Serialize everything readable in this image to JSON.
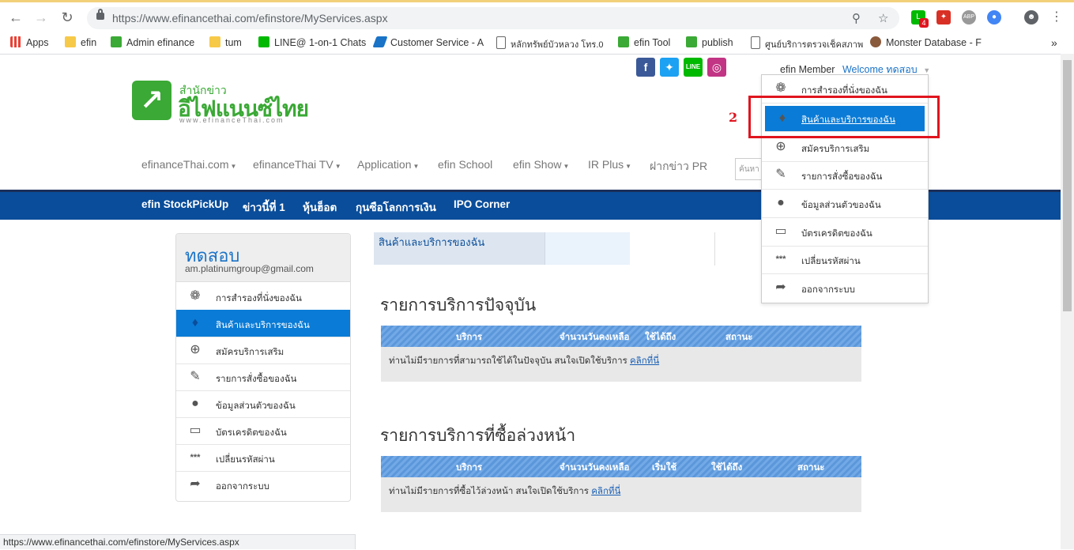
{
  "browser": {
    "url": "https://www.efinancethai.com/efinstore/MyServices.aspx",
    "bookmarks": [
      {
        "label": "Apps",
        "icon": "apps-grid-icon",
        "color": "#e94235"
      },
      {
        "label": "efin",
        "icon": "folder-icon",
        "color": "#f7c948"
      },
      {
        "label": "Admin efinance",
        "icon": "efin-icon",
        "color": "#3aa935"
      },
      {
        "label": "tum",
        "icon": "folder-icon",
        "color": "#f7c948"
      },
      {
        "label": "LINE@ 1-on-1 Chats",
        "icon": "line-icon",
        "color": "#00b900"
      },
      {
        "label": "Customer Service - A",
        "icon": "ticket-icon",
        "color": "#1a73c7"
      },
      {
        "label": "หลักทรัพย์บัวหลวง โทร.0",
        "icon": "page-icon",
        "color": "#ffffff"
      },
      {
        "label": "efin Tool",
        "icon": "efin-icon",
        "color": "#3aa935"
      },
      {
        "label": "publish",
        "icon": "efin-icon",
        "color": "#3aa935"
      },
      {
        "label": "ศูนย์บริการตรวจเช็คสภาพ",
        "icon": "page-icon",
        "color": "#ffffff"
      },
      {
        "label": "Monster Database - F",
        "icon": "monster-icon",
        "color": "#8a5a3c"
      }
    ],
    "status_url": "https://www.efinancethai.com/efinstore/MyServices.aspx",
    "ext_badge": "4",
    "ext_abp": "ABP"
  },
  "header": {
    "logo_line1": "สำนักข่าว",
    "logo_line2": "อีไฟแนนซ์ไทย",
    "logo_line3": "www.efinanceThai.com",
    "social": [
      {
        "name": "facebook",
        "glyph": "f",
        "color": "#3b5998"
      },
      {
        "name": "twitter",
        "glyph": "t",
        "color": "#1da1f2"
      },
      {
        "name": "line",
        "glyph": "L",
        "color": "#00b900"
      },
      {
        "name": "instagram",
        "glyph": "◎",
        "color": "#c13584"
      }
    ],
    "member_label": "efin Member",
    "welcome_label": "Welcome ทดสอบ",
    "search_placeholder": "ค้นหา"
  },
  "topnav": [
    "efinanceThai.com",
    "efinanceThai TV",
    "Application",
    "efin School",
    "efin Show",
    "IR Plus",
    "ฝากข่าว PR"
  ],
  "bluebar": [
    "efin StockPickUp",
    "ข่าวนี้ที่ 1",
    "หุ้นฮ็อต",
    "กุนซือโลกการเงิน",
    "IPO Corner"
  ],
  "sidebar": {
    "name": "ทดสอบ",
    "email": "am.platinumgroup@gmail.com",
    "items": [
      {
        "label": "การสำรองที่นั่งของฉัน",
        "icon": "seat-icon"
      },
      {
        "label": "สินค้าและบริการของฉัน",
        "icon": "tag-icon"
      },
      {
        "label": "สมัครบริการเสริม",
        "icon": "add-tag-icon"
      },
      {
        "label": "รายการสั่งซื้อของฉัน",
        "icon": "order-list-icon"
      },
      {
        "label": "ข้อมูลส่วนตัวของฉัน",
        "icon": "user-icon"
      },
      {
        "label": "บัตรเครดิตของฉัน",
        "icon": "credit-card-icon"
      },
      {
        "label": "เปลี่ยนรหัสผ่าน",
        "icon": "password-icon"
      },
      {
        "label": "ออกจากระบบ",
        "icon": "logout-icon"
      }
    ]
  },
  "main": {
    "tab_label": "สินค้าและบริการของฉัน",
    "current": {
      "title": "รายการบริการปัจจุบัน",
      "headers": [
        "บริการ",
        "จำนวนวันคงเหลือ",
        "ใช้ได้ถึง",
        "สถานะ"
      ],
      "message": "ท่านไม่มีรายการที่สามารถใช้ได้ในปัจจุบัน สนใจเปิดใช้บริการ",
      "link": "คลิกที่นี่"
    },
    "advance": {
      "title": "รายการบริการที่ซื้อล่วงหน้า",
      "headers": [
        "บริการ",
        "จำนวนวันคงเหลือ",
        "เริ่มใช้",
        "ใช้ได้ถึง",
        "สถานะ"
      ],
      "message": "ท่านไม่มีรายการที่ซื้อไว้ล่วงหน้า สนใจเปิดใช้บริการ",
      "link": "คลิกที่นี่"
    }
  },
  "dropdown": {
    "items": [
      {
        "label": "การสำรองที่นั่งของฉัน",
        "icon": "seat-icon"
      },
      {
        "label": "สินค้าและบริการของฉัน",
        "icon": "tag-icon"
      },
      {
        "label": "สมัครบริการเสริม",
        "icon": "add-tag-icon"
      },
      {
        "label": "รายการสั่งซื้อของฉัน",
        "icon": "order-list-icon"
      },
      {
        "label": "ข้อมูลส่วนตัวของฉัน",
        "icon": "user-icon"
      },
      {
        "label": "บัตรเครดิตของฉัน",
        "icon": "credit-card-icon"
      },
      {
        "label": "เปลี่ยนรหัสผ่าน",
        "icon": "password-icon"
      },
      {
        "label": "ออกจากระบบ",
        "icon": "logout-icon"
      }
    ]
  },
  "annotation": {
    "number": "2",
    "color": "#e0141e"
  },
  "colors": {
    "brand_green": "#3aa935",
    "nav_blue": "#0a4d9a",
    "active_blue": "#0a7bd6",
    "link_blue": "#1a73c7"
  }
}
